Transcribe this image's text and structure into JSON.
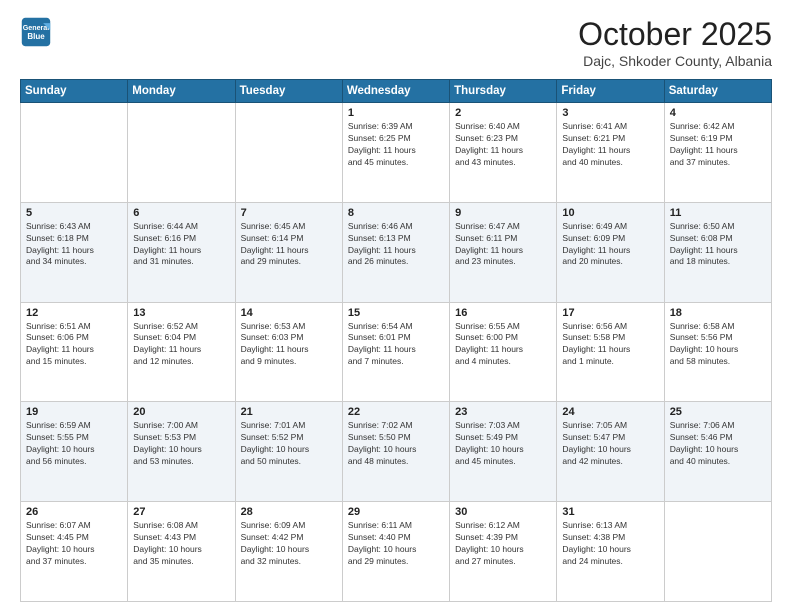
{
  "header": {
    "logo_line1": "General",
    "logo_line2": "Blue",
    "month": "October 2025",
    "location": "Dajc, Shkoder County, Albania"
  },
  "weekdays": [
    "Sunday",
    "Monday",
    "Tuesday",
    "Wednesday",
    "Thursday",
    "Friday",
    "Saturday"
  ],
  "weeks": [
    [
      {
        "day": "",
        "text": ""
      },
      {
        "day": "",
        "text": ""
      },
      {
        "day": "",
        "text": ""
      },
      {
        "day": "1",
        "text": "Sunrise: 6:39 AM\nSunset: 6:25 PM\nDaylight: 11 hours\nand 45 minutes."
      },
      {
        "day": "2",
        "text": "Sunrise: 6:40 AM\nSunset: 6:23 PM\nDaylight: 11 hours\nand 43 minutes."
      },
      {
        "day": "3",
        "text": "Sunrise: 6:41 AM\nSunset: 6:21 PM\nDaylight: 11 hours\nand 40 minutes."
      },
      {
        "day": "4",
        "text": "Sunrise: 6:42 AM\nSunset: 6:19 PM\nDaylight: 11 hours\nand 37 minutes."
      }
    ],
    [
      {
        "day": "5",
        "text": "Sunrise: 6:43 AM\nSunset: 6:18 PM\nDaylight: 11 hours\nand 34 minutes."
      },
      {
        "day": "6",
        "text": "Sunrise: 6:44 AM\nSunset: 6:16 PM\nDaylight: 11 hours\nand 31 minutes."
      },
      {
        "day": "7",
        "text": "Sunrise: 6:45 AM\nSunset: 6:14 PM\nDaylight: 11 hours\nand 29 minutes."
      },
      {
        "day": "8",
        "text": "Sunrise: 6:46 AM\nSunset: 6:13 PM\nDaylight: 11 hours\nand 26 minutes."
      },
      {
        "day": "9",
        "text": "Sunrise: 6:47 AM\nSunset: 6:11 PM\nDaylight: 11 hours\nand 23 minutes."
      },
      {
        "day": "10",
        "text": "Sunrise: 6:49 AM\nSunset: 6:09 PM\nDaylight: 11 hours\nand 20 minutes."
      },
      {
        "day": "11",
        "text": "Sunrise: 6:50 AM\nSunset: 6:08 PM\nDaylight: 11 hours\nand 18 minutes."
      }
    ],
    [
      {
        "day": "12",
        "text": "Sunrise: 6:51 AM\nSunset: 6:06 PM\nDaylight: 11 hours\nand 15 minutes."
      },
      {
        "day": "13",
        "text": "Sunrise: 6:52 AM\nSunset: 6:04 PM\nDaylight: 11 hours\nand 12 minutes."
      },
      {
        "day": "14",
        "text": "Sunrise: 6:53 AM\nSunset: 6:03 PM\nDaylight: 11 hours\nand 9 minutes."
      },
      {
        "day": "15",
        "text": "Sunrise: 6:54 AM\nSunset: 6:01 PM\nDaylight: 11 hours\nand 7 minutes."
      },
      {
        "day": "16",
        "text": "Sunrise: 6:55 AM\nSunset: 6:00 PM\nDaylight: 11 hours\nand 4 minutes."
      },
      {
        "day": "17",
        "text": "Sunrise: 6:56 AM\nSunset: 5:58 PM\nDaylight: 11 hours\nand 1 minute."
      },
      {
        "day": "18",
        "text": "Sunrise: 6:58 AM\nSunset: 5:56 PM\nDaylight: 10 hours\nand 58 minutes."
      }
    ],
    [
      {
        "day": "19",
        "text": "Sunrise: 6:59 AM\nSunset: 5:55 PM\nDaylight: 10 hours\nand 56 minutes."
      },
      {
        "day": "20",
        "text": "Sunrise: 7:00 AM\nSunset: 5:53 PM\nDaylight: 10 hours\nand 53 minutes."
      },
      {
        "day": "21",
        "text": "Sunrise: 7:01 AM\nSunset: 5:52 PM\nDaylight: 10 hours\nand 50 minutes."
      },
      {
        "day": "22",
        "text": "Sunrise: 7:02 AM\nSunset: 5:50 PM\nDaylight: 10 hours\nand 48 minutes."
      },
      {
        "day": "23",
        "text": "Sunrise: 7:03 AM\nSunset: 5:49 PM\nDaylight: 10 hours\nand 45 minutes."
      },
      {
        "day": "24",
        "text": "Sunrise: 7:05 AM\nSunset: 5:47 PM\nDaylight: 10 hours\nand 42 minutes."
      },
      {
        "day": "25",
        "text": "Sunrise: 7:06 AM\nSunset: 5:46 PM\nDaylight: 10 hours\nand 40 minutes."
      }
    ],
    [
      {
        "day": "26",
        "text": "Sunrise: 6:07 AM\nSunset: 4:45 PM\nDaylight: 10 hours\nand 37 minutes."
      },
      {
        "day": "27",
        "text": "Sunrise: 6:08 AM\nSunset: 4:43 PM\nDaylight: 10 hours\nand 35 minutes."
      },
      {
        "day": "28",
        "text": "Sunrise: 6:09 AM\nSunset: 4:42 PM\nDaylight: 10 hours\nand 32 minutes."
      },
      {
        "day": "29",
        "text": "Sunrise: 6:11 AM\nSunset: 4:40 PM\nDaylight: 10 hours\nand 29 minutes."
      },
      {
        "day": "30",
        "text": "Sunrise: 6:12 AM\nSunset: 4:39 PM\nDaylight: 10 hours\nand 27 minutes."
      },
      {
        "day": "31",
        "text": "Sunrise: 6:13 AM\nSunset: 4:38 PM\nDaylight: 10 hours\nand 24 minutes."
      },
      {
        "day": "",
        "text": ""
      }
    ]
  ]
}
